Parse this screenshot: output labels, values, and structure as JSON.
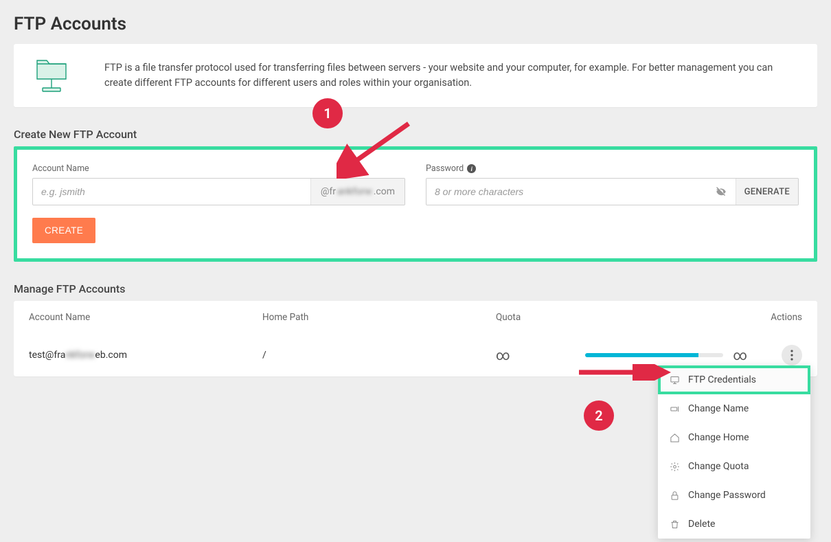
{
  "page": {
    "title": "FTP Accounts",
    "description": "FTP is a file transfer protocol used for transferring files between servers - your website and your computer, for example. For better management you can create different FTP accounts for different users and roles within your organisation."
  },
  "create": {
    "section_title": "Create New FTP Account",
    "account_label": "Account Name",
    "account_placeholder": "e.g. jsmith",
    "domain_prefix": "@fr",
    "domain_obscured": "ankforw",
    "domain_suffix": ".com",
    "password_label": "Password",
    "password_placeholder": "8 or more characters",
    "generate_label": "GENERATE",
    "create_button": "CREATE"
  },
  "manage": {
    "section_title": "Manage FTP Accounts",
    "headers": {
      "account": "Account Name",
      "home": "Home Path",
      "quota": "Quota",
      "actions": "Actions"
    },
    "row": {
      "account_prefix": "test@fra",
      "account_obscured": "nkforw",
      "account_suffix": "eb.com",
      "home_path": "/",
      "quota": "∞",
      "usage_end": "∞"
    }
  },
  "menu": {
    "credentials": "FTP Credentials",
    "change_name": "Change Name",
    "change_home": "Change Home",
    "change_quota": "Change Quota",
    "change_password": "Change Password",
    "delete": "Delete"
  },
  "annotations": {
    "badge1": "1",
    "badge2": "2"
  }
}
